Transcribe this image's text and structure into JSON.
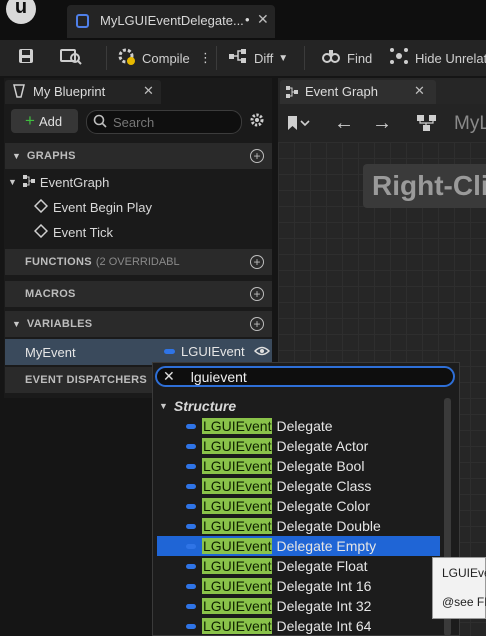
{
  "tab": {
    "title": "MyLGUIEventDelegate...",
    "dirty": "•"
  },
  "toolbar": {
    "compile": "Compile",
    "diff": "Diff",
    "find": "Find",
    "hide_unrelated": "Hide Unrelate"
  },
  "my_blueprint": {
    "title": "My Blueprint",
    "add": "Add",
    "search_placeholder": "Search",
    "graphs": "GRAPHS",
    "event_graph": "EventGraph",
    "event_begin_play": "Event Begin Play",
    "event_tick": "Event Tick",
    "functions": "FUNCTIONS",
    "functions_note": "(2 OVERRIDABL",
    "macros": "MACROS",
    "variables": "VARIABLES",
    "var_name": "MyEvent",
    "var_type": "LGUIEvent",
    "event_dispatchers": "EVENT DISPATCHERS"
  },
  "graph": {
    "tab_title": "Event Graph",
    "breadcrumb": "MyL",
    "hint": "Right-Cli"
  },
  "picker": {
    "query": "lguievent",
    "category": "Structure",
    "match": "LGUIEvent",
    "selected_index": 6,
    "options": [
      "Delegate",
      "Delegate Actor",
      "Delegate Bool",
      "Delegate Class",
      "Delegate Color",
      "Delegate Double",
      "Delegate Empty",
      "Delegate Float",
      "Delegate Int 16",
      "Delegate Int 32",
      "Delegate Int 64"
    ]
  },
  "tooltip": {
    "line1": "LGUIEve",
    "line2": "@see FL"
  },
  "colors": {
    "accent": "#1f65d6",
    "match": "#8ac34a",
    "pin": "#2f74e6"
  }
}
